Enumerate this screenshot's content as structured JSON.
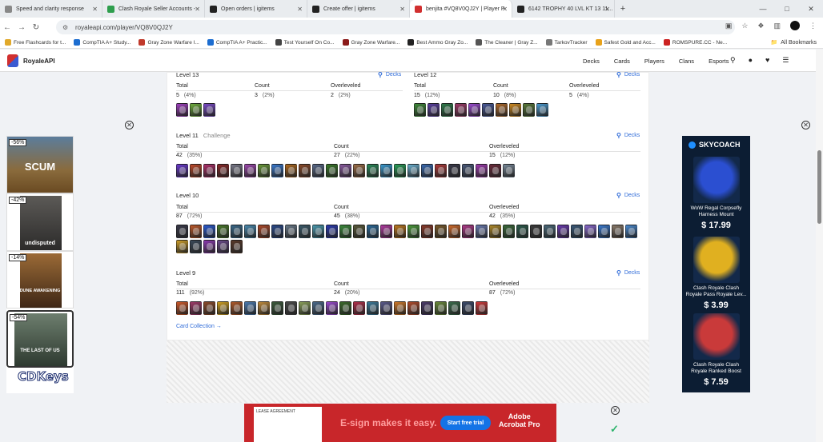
{
  "browser": {
    "tabs": [
      {
        "title": "Speed and clarity response",
        "color": "#888888"
      },
      {
        "title": "Clash Royale Seller Accounts - ",
        "color": "#2e9e4d"
      },
      {
        "title": "Open orders | igitems",
        "color": "#222222"
      },
      {
        "title": "Create offer | igitems",
        "color": "#222222"
      },
      {
        "title": "benjita #VQ8V0QJ2Y | Player P",
        "color": "#d12f2f",
        "active": true
      },
      {
        "title": "6142 TROPHY 40 LVL KT 13 11...",
        "color": "#222222"
      }
    ],
    "url": "royaleapi.com/player/VQ8V0QJ2Y",
    "bookmarks": [
      {
        "label": "Free Flashcards for t...",
        "color": "#e1a92a"
      },
      {
        "label": "CompTIA A+ Study...",
        "color": "#1c6dd0"
      },
      {
        "label": "Gray Zone Warfare I...",
        "color": "#c0392b"
      },
      {
        "label": "CompTIA A+ Practic...",
        "color": "#1c6dd0"
      },
      {
        "label": "Test Yourself On Co...",
        "color": "#444444"
      },
      {
        "label": "Gray Zone Warfare...",
        "color": "#8b1a1a"
      },
      {
        "label": "Best Ammo Gray Zo...",
        "color": "#222222"
      },
      {
        "label": "The Cleaner | Gray Z...",
        "color": "#555555"
      },
      {
        "label": "TarkovTracker",
        "color": "#777777"
      },
      {
        "label": "Safest Gold and Acc...",
        "color": "#e8a21a"
      },
      {
        "label": "ROMSPURE.CC - Ne...",
        "color": "#cc2222"
      }
    ],
    "all_bookmarks": "All Bookmarks"
  },
  "site": {
    "brand": "RoyaleAPI",
    "nav": [
      "Decks",
      "Cards",
      "Players",
      "Clans",
      "Esports"
    ]
  },
  "sections": {
    "lvl13": {
      "title": "Level 13",
      "decks": "Decks",
      "total_label": "Total",
      "count_label": "Count",
      "over_label": "Overleveled",
      "total": "5",
      "total_pct": "(4%)",
      "count": "3",
      "count_pct": "(2%)",
      "over": "2",
      "over_pct": "(2%)",
      "cards": [
        "#a040c0",
        "#6fae3d",
        "#7a4bc8"
      ]
    },
    "lvl12": {
      "title": "Level 12",
      "decks": "Decks",
      "total_label": "Total",
      "count_label": "Count",
      "over_label": "Overleveled",
      "total": "15",
      "total_pct": "(12%)",
      "count": "10",
      "count_pct": "(8%)",
      "over": "5",
      "over_pct": "(4%)",
      "cards": [
        "#3f8a3a",
        "#5a3fa0",
        "#2f7a4a",
        "#a03a6a",
        "#9a4ad0",
        "#4a5a9a",
        "#b06a2a",
        "#d08a20",
        "#5a7a3a",
        "#4a9ad0"
      ]
    },
    "lvl11": {
      "title": "Level 11",
      "subtitle": "Challenge",
      "decks": "Decks",
      "total_label": "Total",
      "count_label": "Count",
      "over_label": "Overleveled",
      "total": "42",
      "total_pct": "(35%)",
      "count": "27",
      "count_pct": "(22%)",
      "over": "15",
      "over_pct": "(12%)",
      "cards": [
        "#6a3ad0",
        "#c04a2a",
        "#b0306a",
        "#8a2a2a",
        "#7a7a8a",
        "#a04ab0",
        "#6a9a3a",
        "#3a7ad0",
        "#b06a20",
        "#8a4a2a",
        "#5a6a8a",
        "#3a7a2a",
        "#8a5aa0",
        "#a0704a",
        "#2a8a5a",
        "#3a9ad0",
        "#2aa05a",
        "#6ab0d0",
        "#3a6ab0",
        "#b03a3a",
        "#3a3a4a",
        "#4a5a7a",
        "#a03ab0",
        "#6a2a3a",
        "#7a8a9a"
      ]
    },
    "lvl10": {
      "title": "Level 10",
      "decks": "Decks",
      "total_label": "Total",
      "count_label": "Count",
      "over_label": "Overleveled",
      "total": "87",
      "total_pct": "(72%)",
      "count": "45",
      "count_pct": "(38%)",
      "over": "42",
      "over_pct": "(35%)",
      "cards": [
        "#3a3a4a",
        "#c05a2a",
        "#2a5ad0",
        "#4a7a2a",
        "#3a6a8a",
        "#4a8ab0",
        "#b04a2a",
        "#2a4a8a",
        "#6a7a8a",
        "#3a5a6a",
        "#4a9ab0",
        "#2a3ab0",
        "#3a8a3a",
        "#5a5a3a",
        "#2a6a9a",
        "#b03aa0",
        "#c07a20",
        "#4a9a3a",
        "#8a3a2a",
        "#7a5a2a",
        "#d06a2a",
        "#b03a8a",
        "#6a7ab0",
        "#b08a2a",
        "#3a6a3a",
        "#2a5a4a",
        "#3a3a3a",
        "#4a6a7a",
        "#6a3ab0",
        "#3a5a7a",
        "#8a6ad0",
        "#3a7ad0",
        "#8a7a6a",
        "#4a8ad0",
        "#d0a02a",
        "#3a4a5a",
        "#8a3ab0",
        "#6a4a8a",
        "#5a3a2a"
      ]
    },
    "lvl9": {
      "title": "Level 9",
      "decks": "Decks",
      "total_label": "Total",
      "count_label": "Count",
      "over_label": "Overleveled",
      "total": "111",
      "total_pct": "(92%)",
      "count": "24",
      "count_pct": "(20%)",
      "over": "87",
      "over_pct": "(72%)",
      "cards": [
        "#d05a2a",
        "#a03a6a",
        "#8a4a2a",
        "#d0a020",
        "#b05a2a",
        "#4a7ab0",
        "#c08a3a",
        "#3a5a3a",
        "#4a4a4a",
        "#8aa05a",
        "#4a6a8a",
        "#9a4ad0",
        "#3a6a2a",
        "#b0304a",
        "#3a7a9a",
        "#5a5a8a",
        "#d07a2a",
        "#b04a2a",
        "#4a3a6a",
        "#6a8a3a",
        "#3a6a4a",
        "#3a4a6a",
        "#d03a3a"
      ]
    },
    "card_collection": "Card Collection →"
  },
  "ads": {
    "left": {
      "items": [
        {
          "pct": "-56%",
          "title": "SCUM"
        },
        {
          "pct": "-42%",
          "title": "undisputed"
        },
        {
          "pct": "-14%",
          "title": "DUNE AWAKENING"
        },
        {
          "pct": "-54%",
          "title": "THE LAST OF US"
        }
      ],
      "brand": "CDKeys"
    },
    "right": {
      "brand": "SKYCOACH",
      "products": [
        {
          "name": "WoW Regal Corpsefly Harness Mount",
          "price": "$ 17.99",
          "color": "#2b4fd1"
        },
        {
          "name": "Clash Royale Clash Royale Pass Royale Lev...",
          "price": "$ 3.99",
          "color": "#e0b020"
        },
        {
          "name": "Clash Royale Clash Royale Ranked Boost",
          "price": "$ 7.59",
          "color": "#c93a3a"
        }
      ]
    },
    "bottom": {
      "lease": "LEASE AGREEMENT",
      "headline": "E-sign makes it easy.",
      "button": "Start free trial",
      "brand1": "Adobe",
      "brand2": "Acrobat Pro"
    }
  }
}
